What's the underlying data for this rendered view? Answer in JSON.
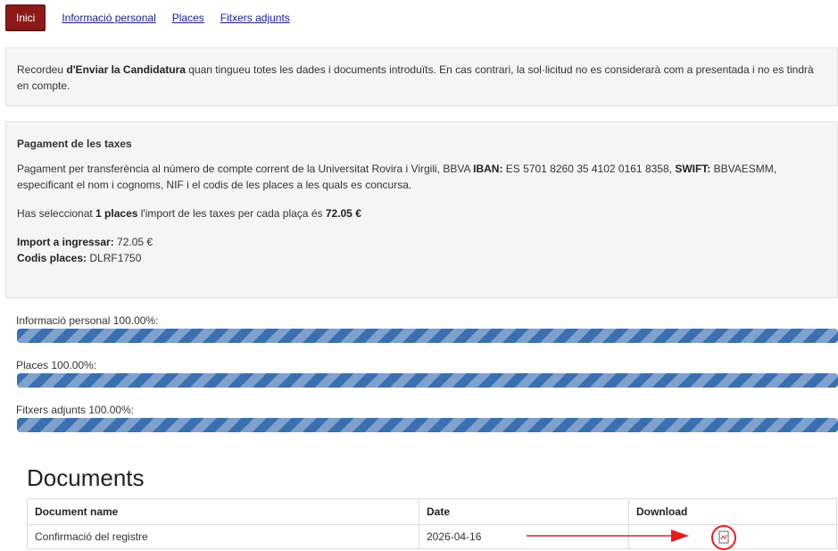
{
  "tabs": {
    "active": "Inici",
    "links": [
      "Informació personal",
      "Places",
      "Fitxers adjunts"
    ]
  },
  "notice": {
    "before": "Recordeu ",
    "bold": "d'Enviar la Candidatura",
    "after": " quan tingueu totes les dades i documents introduïts. En cas contrari, la sol·licitud no es considerarà com a presentada i no es tindrà en compte."
  },
  "payment": {
    "title": "Pagament de les taxes",
    "p1_a": "Pagament per transferència al número de compte corrent de la Universitat Rovira i Virgili, BBVA ",
    "iban_label": "IBAN:",
    "p1_b": " ES 5701 8260 35 4102 0161 8358, ",
    "swift_label": "SWIFT:",
    "p1_c": " BBVAESMM, especificant el nom i cognoms, NIF i el codis de les places a les quals es concursa.",
    "p2_a": "Has seleccionat ",
    "p2_count": "1 places",
    "p2_b": " l'import de les taxes per cada plaça és ",
    "p2_amount": "72.05 €",
    "import_label": "Import a ingressar:",
    "import_value": " 72.05 €",
    "codes_label": "Codis places:",
    "codes_value": " DLRF1750"
  },
  "progress": [
    {
      "label": "Informació personal 100.00%:",
      "value": 1.0
    },
    {
      "label": "Places 100.00%:",
      "value": 1.0
    },
    {
      "label": "Fitxers adjunts 100.00%:",
      "value": 1.0
    }
  ],
  "documents": {
    "title": "Documents",
    "headers": [
      "Document name",
      "Date",
      "Download"
    ],
    "rows": [
      {
        "name": "Confirmació del registre",
        "date": "2026-04-16",
        "download_icon": "pdf-file-icon"
      }
    ]
  },
  "colors": {
    "active_tab": "#8b1a1a",
    "progress_bar": "#3a6fb0",
    "annotation": "#e02020"
  }
}
